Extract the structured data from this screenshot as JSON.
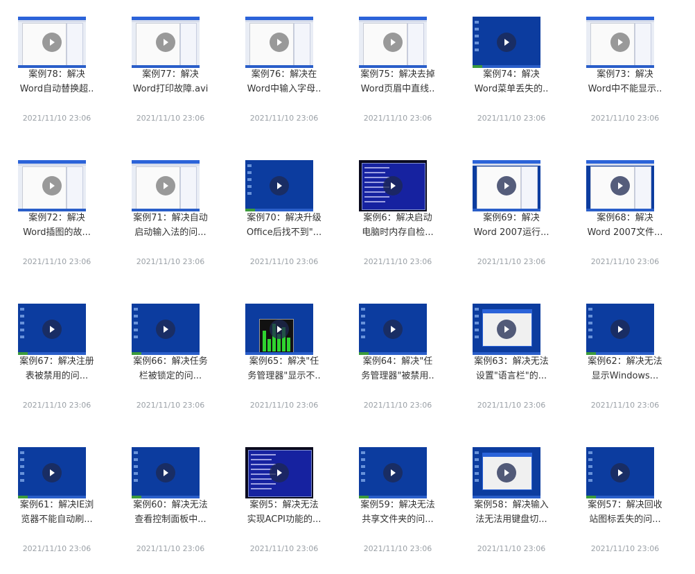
{
  "items": [
    {
      "title": "案例78：解决\nWord自动替换超..",
      "date": "2021/11/10 23:06",
      "thumb": "word"
    },
    {
      "title": "案例77：解决\nWord打印故障.avi",
      "date": "2021/11/10 23:06",
      "thumb": "word"
    },
    {
      "title": "案例76：解决在\nWord中输入字母..",
      "date": "2021/11/10 23:06",
      "thumb": "word"
    },
    {
      "title": "案例75：解决去掉\nWord页眉中直线..",
      "date": "2021/11/10 23:06",
      "thumb": "word"
    },
    {
      "title": "案例74：解决\nWord菜单丢失的..",
      "date": "2021/11/10 23:06",
      "thumb": "winxp"
    },
    {
      "title": "案例73：解决\nWord中不能显示..",
      "date": "2021/11/10 23:06",
      "thumb": "word"
    },
    {
      "title": "案例72：解决\nWord插图的故...",
      "date": "2021/11/10 23:06",
      "thumb": "word"
    },
    {
      "title": "案例71：解决自动\n启动输入法的问...",
      "date": "2021/11/10 23:06",
      "thumb": "word"
    },
    {
      "title": "案例70：解决升级\nOffice后找不到\"...",
      "date": "2021/11/10 23:06",
      "thumb": "winxp"
    },
    {
      "title": "案例6：解决启动\n电脑时内存自检...",
      "date": "2021/11/10 23:06",
      "thumb": "bios"
    },
    {
      "title": "案例69：解决\nWord 2007运行...",
      "date": "2021/11/10 23:06",
      "thumb": "winword"
    },
    {
      "title": "案例68：解决\nWord 2007文件...",
      "date": "2021/11/10 23:06",
      "thumb": "winword"
    },
    {
      "title": "案例67：解决注册\n表被禁用的问...",
      "date": "2021/11/10 23:06",
      "thumb": "winxp"
    },
    {
      "title": "案例66：解决任务\n栏被锁定的问...",
      "date": "2021/11/10 23:06",
      "thumb": "winxp"
    },
    {
      "title": "案例65：解决\"任\n务管理器\"显示不..",
      "date": "2021/11/10 23:06",
      "thumb": "taskmgr"
    },
    {
      "title": "案例64：解决\"任\n务管理器\"被禁用..",
      "date": "2021/11/10 23:06",
      "thumb": "winxp"
    },
    {
      "title": "案例63：解决无法\n设置\"语言栏\"的...",
      "date": "2021/11/10 23:06",
      "thumb": "dialog"
    },
    {
      "title": "案例62：解决无法\n显示Windows...",
      "date": "2021/11/10 23:06",
      "thumb": "winxp"
    },
    {
      "title": "案例61：解决IE浏\n览器不能自动刷...",
      "date": "2021/11/10 23:06",
      "thumb": "winxp"
    },
    {
      "title": "案例60：解决无法\n查看控制面板中...",
      "date": "2021/11/10 23:06",
      "thumb": "winxp"
    },
    {
      "title": "案例5：解决无法\n实现ACPI功能的...",
      "date": "2021/11/10 23:06",
      "thumb": "bios"
    },
    {
      "title": "案例59：解决无法\n共享文件夹的问...",
      "date": "2021/11/10 23:06",
      "thumb": "winxp"
    },
    {
      "title": "案例58：解决输入\n法无法用键盘切...",
      "date": "2021/11/10 23:06",
      "thumb": "dialog"
    },
    {
      "title": "案例57：解决回收\n站图标丢失的问...",
      "date": "2021/11/10 23:06",
      "thumb": "winxp"
    }
  ],
  "icons": {
    "play": "play-icon"
  }
}
